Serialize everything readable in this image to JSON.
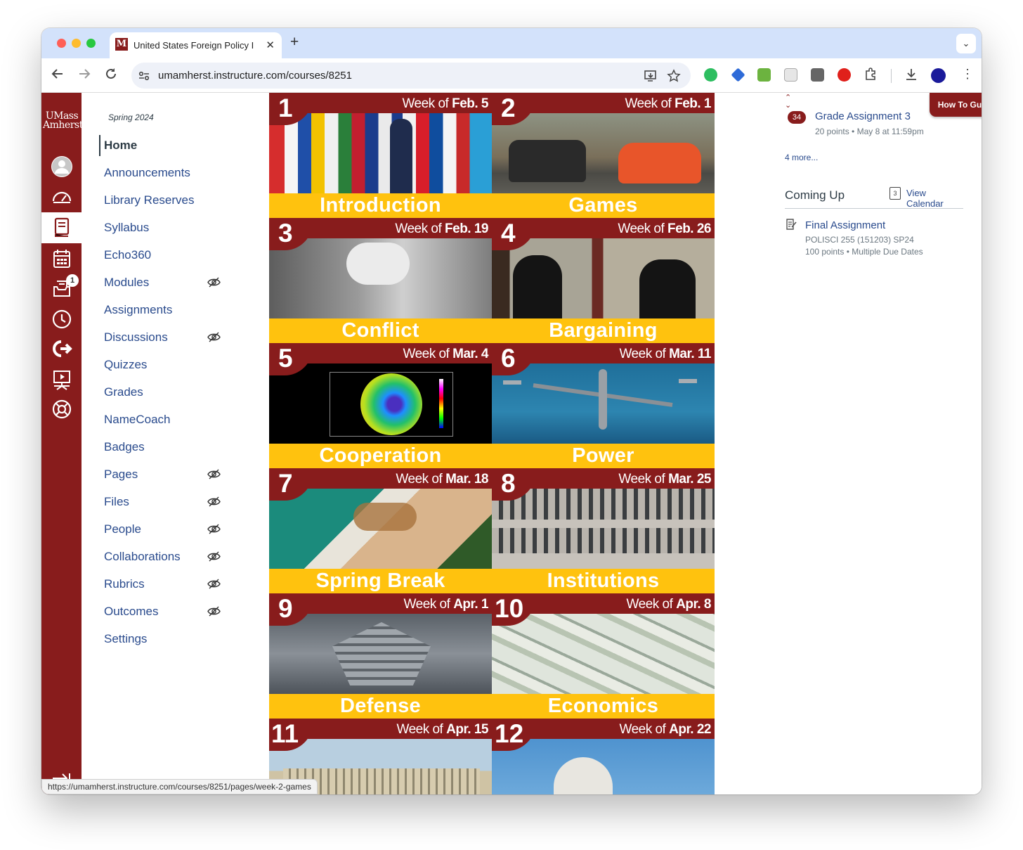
{
  "browser": {
    "tab_title": "United States Foreign Policy I",
    "url": "umamherst.instructure.com/courses/8251",
    "status_url": "https://umamherst.instructure.com/courses/8251/pages/week-2-games"
  },
  "global_nav": {
    "logo_line1": "UMass",
    "logo_line2": "Amherst",
    "inbox_count": "1"
  },
  "course_nav": {
    "term": "Spring 2024",
    "items": [
      {
        "label": "Home"
      },
      {
        "label": "Announcements"
      },
      {
        "label": "Library Reserves"
      },
      {
        "label": "Syllabus"
      },
      {
        "label": "Echo360"
      },
      {
        "label": "Modules"
      },
      {
        "label": "Assignments"
      },
      {
        "label": "Discussions"
      },
      {
        "label": "Quizzes"
      },
      {
        "label": "Grades"
      },
      {
        "label": "NameCoach"
      },
      {
        "label": "Badges"
      },
      {
        "label": "Pages"
      },
      {
        "label": "Files"
      },
      {
        "label": "People"
      },
      {
        "label": "Collaborations"
      },
      {
        "label": "Rubrics"
      },
      {
        "label": "Outcomes"
      },
      {
        "label": "Settings"
      }
    ]
  },
  "weeks": [
    {
      "num": "1",
      "prefix": "Week of ",
      "date": "Feb. 5",
      "title": "Introduction"
    },
    {
      "num": "2",
      "prefix": "Week of ",
      "date": "Feb. 1",
      "title": "Games"
    },
    {
      "num": "3",
      "prefix": "Week of ",
      "date": "Feb. 19",
      "title": "Conflict"
    },
    {
      "num": "4",
      "prefix": "Week of ",
      "date": "Feb. 26",
      "title": "Bargaining"
    },
    {
      "num": "5",
      "prefix": "Week of ",
      "date": "Mar. 4",
      "title": "Cooperation"
    },
    {
      "num": "6",
      "prefix": "Week of ",
      "date": "Mar. 11",
      "title": "Power"
    },
    {
      "num": "7",
      "prefix": "Week of ",
      "date": "Mar. 18",
      "title": "Spring Break"
    },
    {
      "num": "8",
      "prefix": "Week of ",
      "date": "Mar. 25",
      "title": "Institutions"
    },
    {
      "num": "9",
      "prefix": "Week of ",
      "date": "Apr. 1",
      "title": "Defense"
    },
    {
      "num": "10",
      "prefix": "Week of ",
      "date": "Apr. 8",
      "title": "Economics"
    },
    {
      "num": "11",
      "prefix": "Week of ",
      "date": "Apr. 15",
      "title": ""
    },
    {
      "num": "12",
      "prefix": "Week of ",
      "date": "Apr. 22",
      "title": ""
    }
  ],
  "right_sidebar": {
    "how_to": "How To Guides",
    "todo": {
      "badge": "34",
      "title": "Grade Assignment 3",
      "meta": "20 points • May 8 at 11:59pm"
    },
    "more_link": "4 more...",
    "coming_up": "Coming Up",
    "view_calendar": "View Calendar",
    "calendar_day": "3",
    "upcoming": {
      "title": "Final Assignment",
      "course": "POLISCI 255 (151203) SP24",
      "meta": "100 points • Multiple Due Dates"
    }
  },
  "colors": {
    "umass_maroon": "#881c1c",
    "gold": "#ffc20e",
    "link": "#2a4b8d"
  }
}
